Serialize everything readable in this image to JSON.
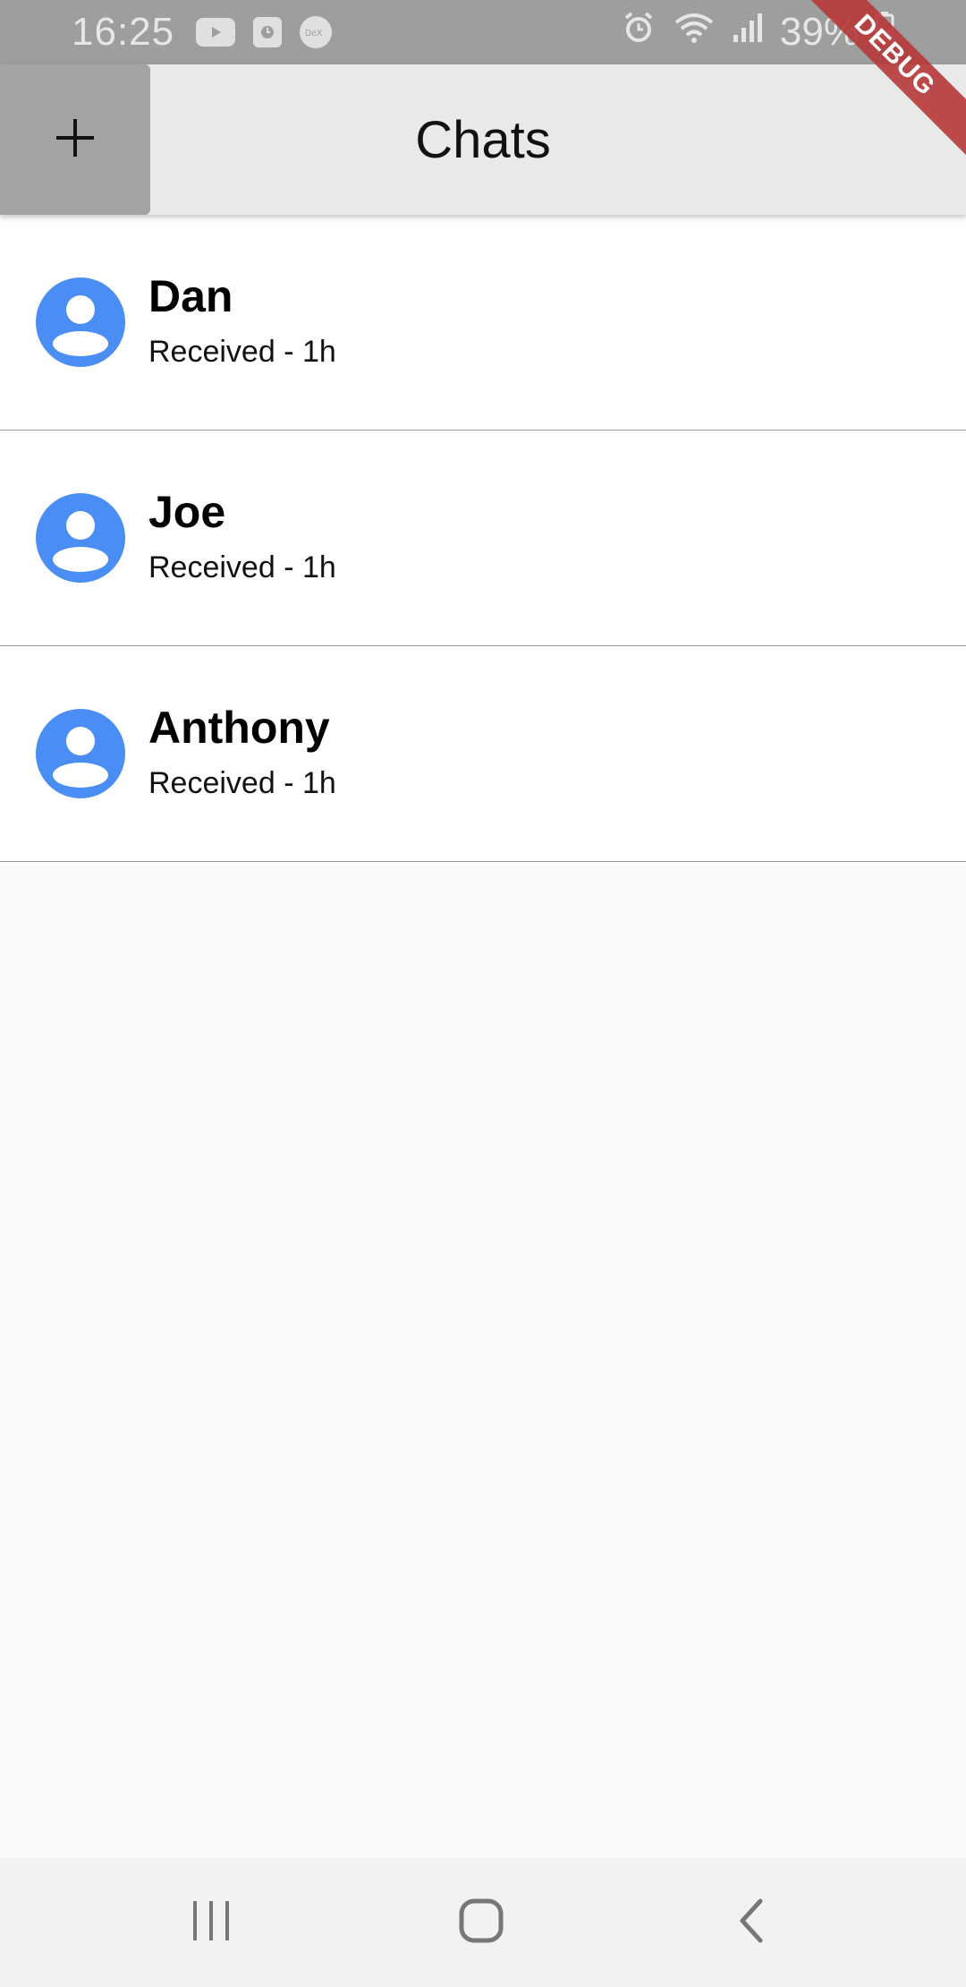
{
  "status_bar": {
    "time": "16:25",
    "battery": "39%"
  },
  "app_bar": {
    "title": "Chats",
    "add_label": "+"
  },
  "debug_banner": "DEBUG",
  "chats": [
    {
      "name": "Dan",
      "subtitle": "Received - 1h"
    },
    {
      "name": "Joe",
      "subtitle": "Received - 1h"
    },
    {
      "name": "Anthony",
      "subtitle": "Received - 1h"
    }
  ],
  "colors": {
    "avatar": "#4a8ef5",
    "app_bar": "#e9e9e9",
    "status_bar": "#9e9e9e",
    "debug_ribbon": "#b73737"
  },
  "icons": {
    "status_left": [
      "youtube-icon",
      "clock-app-icon",
      "dex-icon"
    ],
    "status_right": [
      "alarm-icon",
      "wifi-icon",
      "signal-icon",
      "battery-icon"
    ],
    "nav": [
      "recent-apps-icon",
      "home-icon",
      "back-icon"
    ]
  }
}
